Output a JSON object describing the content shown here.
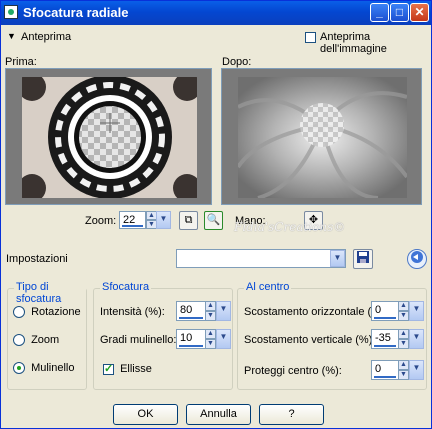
{
  "window": {
    "title": "Sfocatura radiale"
  },
  "preview_section": {
    "collapse_label": "Anteprima",
    "image_preview_label": "Anteprima dell'immagine",
    "image_preview_checked": false
  },
  "before_label": "Prima:",
  "after_label": "Dopo:",
  "zoom": {
    "label": "Zoom:",
    "value": "22"
  },
  "hand_label": "Mano:",
  "watermark": "Fidia'sCreations©",
  "settings": {
    "label": "Impostazioni",
    "value": ""
  },
  "blur_type": {
    "title": "Tipo di sfocatura",
    "options": [
      {
        "label": "Rotazione",
        "checked": false
      },
      {
        "label": "Zoom",
        "checked": false
      },
      {
        "label": "Mulinello",
        "checked": true
      }
    ]
  },
  "blur": {
    "title": "Sfocatura",
    "intensity_label": "Intensità (%):",
    "intensity_value": "80",
    "swirl_label": "Gradi mulinello:",
    "swirl_value": "10",
    "ellipse_label": "Ellisse",
    "ellipse_checked": true
  },
  "off_center": {
    "title": "Al centro",
    "horizontal_label": "Scostamento orizzontale (%):",
    "horizontal_value": "0",
    "vertical_label": "Scostamento verticale (%):",
    "vertical_value": "-35",
    "protect_label": "Proteggi centro (%):",
    "protect_value": "0"
  },
  "buttons": {
    "ok": "OK",
    "cancel": "Annulla",
    "help": "?"
  },
  "colors": {
    "title_bar": "#0447d1",
    "dialog_bg": "#ece9d8",
    "group_title": "#0046d5"
  }
}
